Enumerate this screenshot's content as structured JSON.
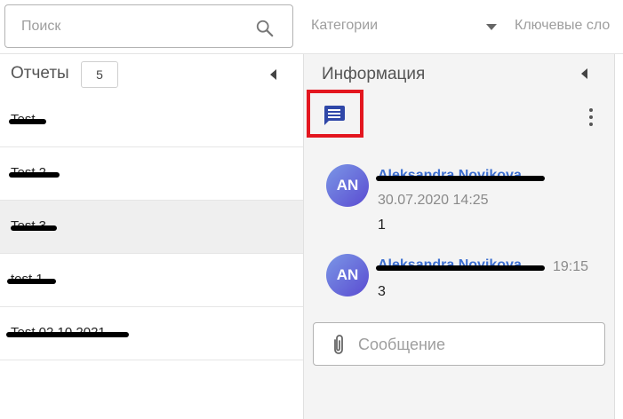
{
  "search": {
    "placeholder": "Поиск"
  },
  "filters": {
    "category_label": "Категории",
    "keywords_label": "Ключевые сло"
  },
  "reports": {
    "title": "Отчеты",
    "count": "5",
    "items": [
      {
        "label": "Test",
        "selected": false
      },
      {
        "label": "Test 2",
        "selected": false
      },
      {
        "label": "Test 3",
        "selected": true
      },
      {
        "label": "test 1",
        "selected": false
      },
      {
        "label": "Test 02.10.2021",
        "selected": false
      }
    ]
  },
  "info": {
    "title": "Информация",
    "comments": [
      {
        "initials": "AN",
        "author": "Aleksandra Novikova",
        "time": "30.07.2020 14:25",
        "text": "1"
      },
      {
        "initials": "AN",
        "author": "Aleksandra Novikova",
        "time": "19:15",
        "text": "3"
      }
    ],
    "message_placeholder": "Сообщение"
  },
  "colors": {
    "accent": "#3d6fd1",
    "highlight_border": "#e3161f",
    "comments_icon": "#2f47a8",
    "selected_row": "#efefef"
  },
  "icons": {
    "search": "search-icon",
    "dropdown": "chevron-down-icon",
    "collapse": "chevron-left-icon",
    "comments": "chat-bubble-icon",
    "menu": "more-vertical-icon",
    "attach": "paperclip-icon"
  }
}
